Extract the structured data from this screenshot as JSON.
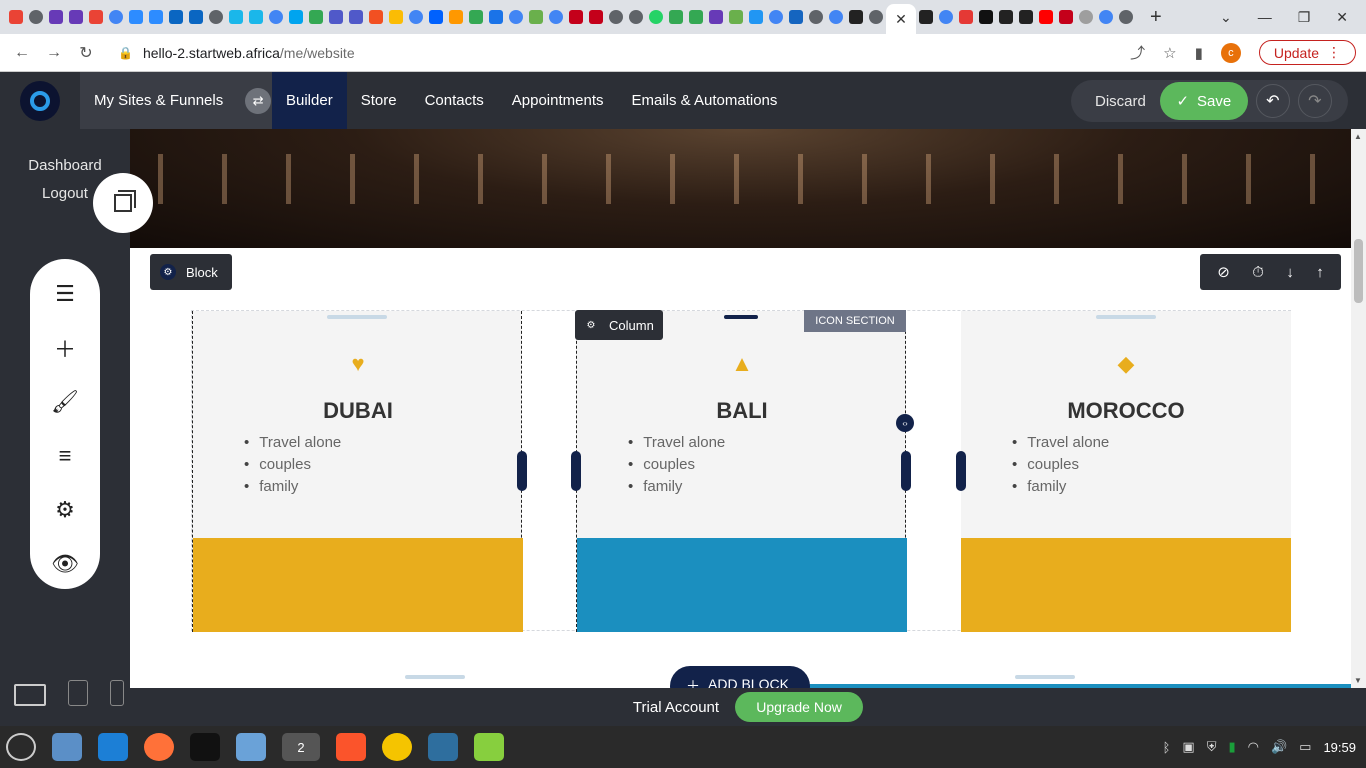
{
  "browser": {
    "url_host": "hello-2.startweb.africa",
    "url_path": "/me/website",
    "update_label": "Update",
    "profile_initial": "c",
    "active_tab_close": "✕",
    "new_tab": "+"
  },
  "topnav": {
    "logo_alt": "STARTWEB",
    "my_sites": "My Sites & Funnels",
    "links": [
      "Builder",
      "Store",
      "Contacts",
      "Appointments",
      "Emails & Automations"
    ],
    "active_link": "Builder",
    "discard": "Discard",
    "save": "Save"
  },
  "sidebar": {
    "dashboard": "Dashboard",
    "logout": "Logout",
    "tools": [
      "menu-icon",
      "plus-icon",
      "brush-icon",
      "filter-icon",
      "gear-icon",
      "eye-icon"
    ]
  },
  "editor": {
    "block_label": "Block",
    "column_label": "Column",
    "icon_section_label": "ICON SECTION",
    "add_block": "ADD BLOCK",
    "columns": [
      {
        "title": "DUBAI",
        "icon": "heart-icon",
        "items": [
          "Travel alone",
          "couples",
          "family"
        ],
        "band_color": "#e8ad1d"
      },
      {
        "title": "BALI",
        "icon": "road-icon",
        "items": [
          "Travel alone",
          "couples",
          "family"
        ],
        "band_color": "#1b8fbf"
      },
      {
        "title": "MOROCCO",
        "icon": "tag-icon",
        "items": [
          "Travel alone",
          "couples",
          "family"
        ],
        "band_color": "#e8ad1d"
      }
    ]
  },
  "footer": {
    "trial": "Trial Account",
    "upgrade": "Upgrade Now"
  },
  "taskbar": {
    "time": "19:59",
    "chrome_badge": "2"
  },
  "colors": {
    "accent_green": "#5cb85c",
    "navy": "#12224a",
    "gold": "#e8ad1d",
    "blue": "#1b8fbf"
  }
}
